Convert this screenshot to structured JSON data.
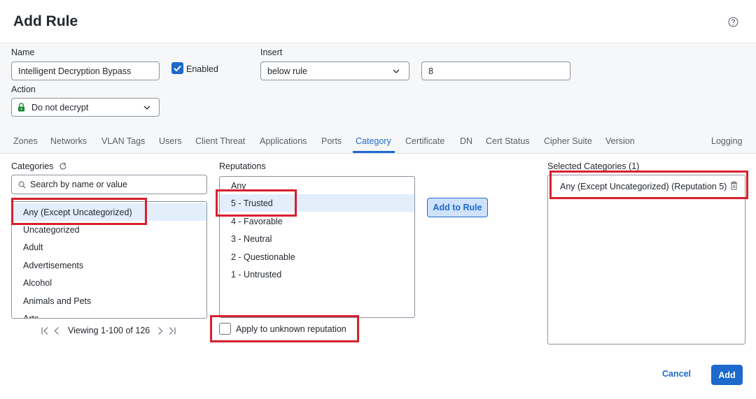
{
  "dialog": {
    "title": "Add Rule"
  },
  "form": {
    "name_label": "Name",
    "name_value": "Intelligent Decryption Bypass",
    "enabled_label": "Enabled",
    "enabled": true,
    "insert_label": "Insert",
    "insert_value": "below rule",
    "insert_rule_number": "8",
    "action_label": "Action",
    "action_value": "Do not decrypt"
  },
  "tabs": [
    {
      "label": "Zones"
    },
    {
      "label": "Networks"
    },
    {
      "label": "VLAN Tags"
    },
    {
      "label": "Users"
    },
    {
      "label": "Client Threat"
    },
    {
      "label": "Applications"
    },
    {
      "label": "Ports"
    },
    {
      "label": "Category"
    },
    {
      "label": "Certificate"
    },
    {
      "label": "DN"
    },
    {
      "label": "Cert Status"
    },
    {
      "label": "Cipher Suite"
    },
    {
      "label": "Version"
    },
    {
      "label": "Logging"
    }
  ],
  "active_tab": "Category",
  "categories": {
    "label": "Categories",
    "search_placeholder": "Search by name or value",
    "items": [
      "Any (Except Uncategorized)",
      "Uncategorized",
      "Adult",
      "Advertisements",
      "Alcohol",
      "Animals and Pets",
      "Arts"
    ],
    "selected": "Any (Except Uncategorized)",
    "pager_text": "Viewing 1-100 of 126"
  },
  "reputations": {
    "label": "Reputations",
    "items": [
      "Any",
      "5 - Trusted",
      "4 - Favorable",
      "3 - Neutral",
      "2 - Questionable",
      "1 - Untrusted"
    ],
    "selected": "5 - Trusted",
    "unknown_label": "Apply to unknown reputation",
    "unknown_checked": false
  },
  "add_to_rule_label": "Add to Rule",
  "selected_categories": {
    "label": "Selected Categories (1)",
    "items": [
      "Any (Except Uncategorized) (Reputation 5)"
    ]
  },
  "footer": {
    "cancel_label": "Cancel",
    "add_label": "Add"
  },
  "colors": {
    "accent": "#1d69cc",
    "highlight": "#d6202e",
    "selected_row": "#e3eefb"
  },
  "icons": [
    "help-icon",
    "check-icon",
    "lock-icon",
    "chevron-down-icon",
    "refresh-icon",
    "search-icon",
    "first-page-icon",
    "prev-page-icon",
    "next-page-icon",
    "last-page-icon",
    "trash-icon"
  ]
}
